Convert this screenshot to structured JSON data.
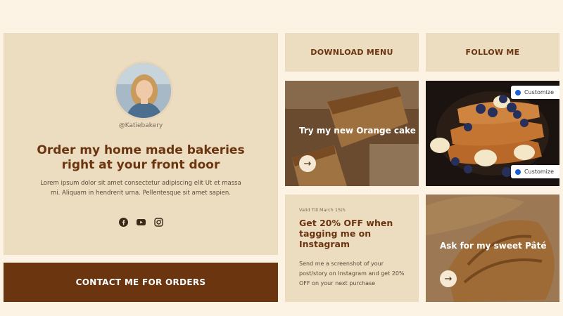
{
  "profile": {
    "handle": "@Katiebakery",
    "headline": "Order my home made bakeries right at your front door",
    "body": "Lorem ipsum dolor sit amet consectetur adipiscing elit Ut et massa mi. Aliquam in hendrerit urna. Pellentesque sit amet sapien.",
    "socials": [
      "facebook-icon",
      "youtube-icon",
      "instagram-icon"
    ]
  },
  "contact": {
    "label": "CONTACT ME FOR ORDERS"
  },
  "download": {
    "label": "DOWNLOAD MENU"
  },
  "follow": {
    "label": "FOLLOW ME"
  },
  "cake_tile": {
    "title": "Try my new Orange cake"
  },
  "promo": {
    "valid": "Valid Till March 15th",
    "title": "Get 20% OFF when tagging me on Instagram",
    "desc": "Send me a screenshot of your post/story on Instagram and get 20% OFF on your next purchase"
  },
  "croissant_tile": {
    "title": "Ask for my sweet Pâté"
  },
  "customize": {
    "label": "Customize"
  },
  "colors": {
    "brand_brown": "#6b3510",
    "panel_beige": "#ecdcc0",
    "page_bg": "#fdf3e4"
  }
}
